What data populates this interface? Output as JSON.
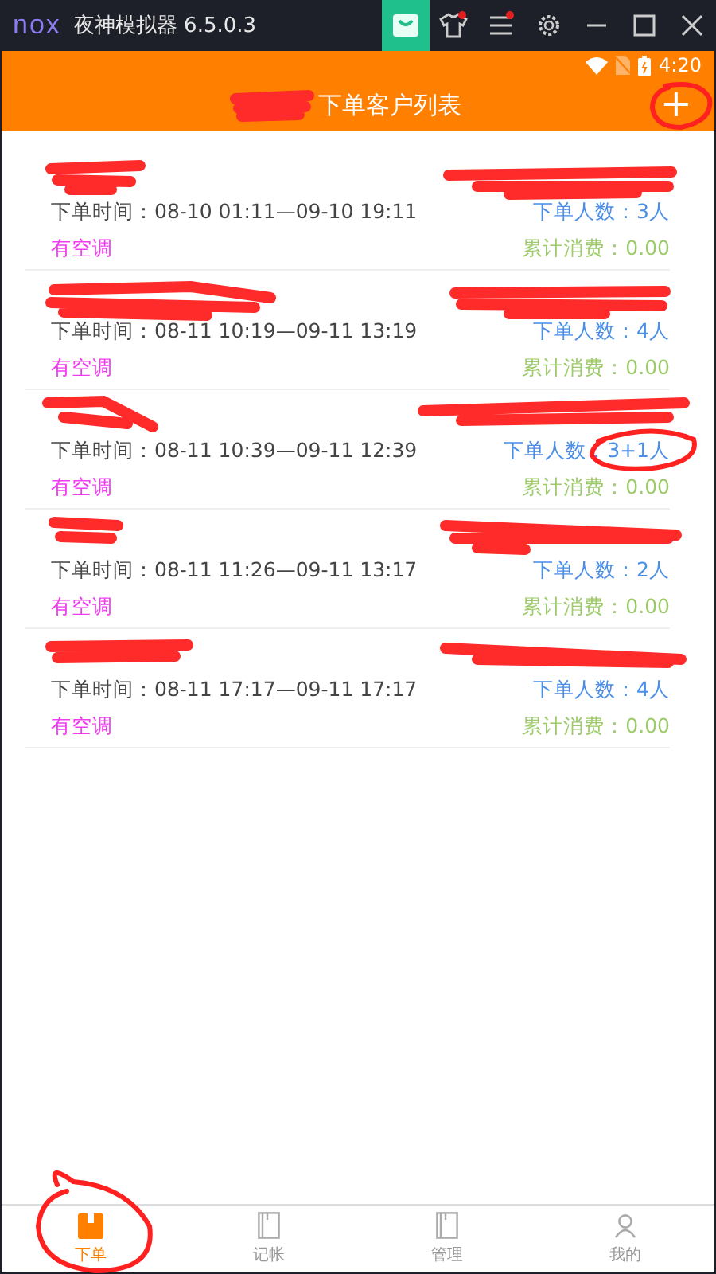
{
  "window": {
    "logo": "nox",
    "title": "夜神模拟器 6.5.0.3"
  },
  "status_bar": {
    "time": "4:20"
  },
  "app_bar": {
    "title": "下单客户列表",
    "action": "+"
  },
  "orders": [
    {
      "time": "下单时间：08-10 01:11—09-10 19:11",
      "count": "下单人数：3人",
      "tag": "有空调",
      "spent": "累计消费：0.00"
    },
    {
      "time": "下单时间：08-11 10:19—09-11 13:19",
      "count": "下单人数：4人",
      "tag": "有空调",
      "spent": "累计消费：0.00"
    },
    {
      "time": "下单时间：08-11 10:39—09-11 12:39",
      "count": "下单人数：3+1人",
      "tag": "有空调",
      "spent": "累计消费：0.00"
    },
    {
      "time": "下单时间：08-11 11:26—09-11 13:17",
      "count": "下单人数：2人",
      "tag": "有空调",
      "spent": "累计消费：0.00"
    },
    {
      "time": "下单时间：08-11 17:17—09-11 17:17",
      "count": "下单人数：4人",
      "tag": "有空调",
      "spent": "累计消费：0.00"
    }
  ],
  "tabs": [
    {
      "label": "下单",
      "kind": "book",
      "selected": true
    },
    {
      "label": "记帐",
      "kind": "book",
      "selected": false
    },
    {
      "label": "管理",
      "kind": "book",
      "selected": false
    },
    {
      "label": "我的",
      "kind": "person",
      "selected": false
    }
  ]
}
